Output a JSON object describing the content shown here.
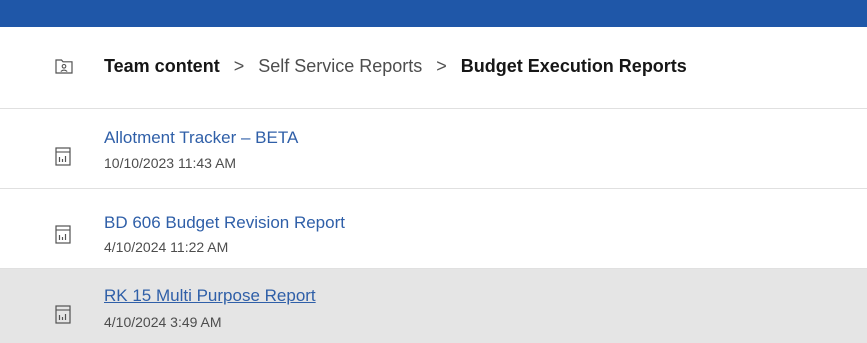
{
  "header": {
    "accent_color": "#1f57a8"
  },
  "breadcrumb": {
    "icon": "folder-user-icon",
    "items": [
      {
        "label": "Team content"
      },
      {
        "label": "Self Service Reports"
      },
      {
        "label": "Budget Execution Reports"
      }
    ],
    "separator": ">"
  },
  "reports": [
    {
      "icon": "report-icon",
      "title": "Allotment Tracker – BETA",
      "modified": "10/10/2023 11:43 AM"
    },
    {
      "icon": "report-icon",
      "title": "BD 606 Budget Revision Report",
      "modified": "4/10/2024 11:22 AM"
    },
    {
      "icon": "report-icon",
      "title": "RK 15 Multi Purpose Report",
      "modified": "4/10/2024 3:49 AM"
    }
  ],
  "colors": {
    "link": "#2f5fa8",
    "hover_row": "#e5e5e5",
    "divider": "#e0e0e0"
  }
}
